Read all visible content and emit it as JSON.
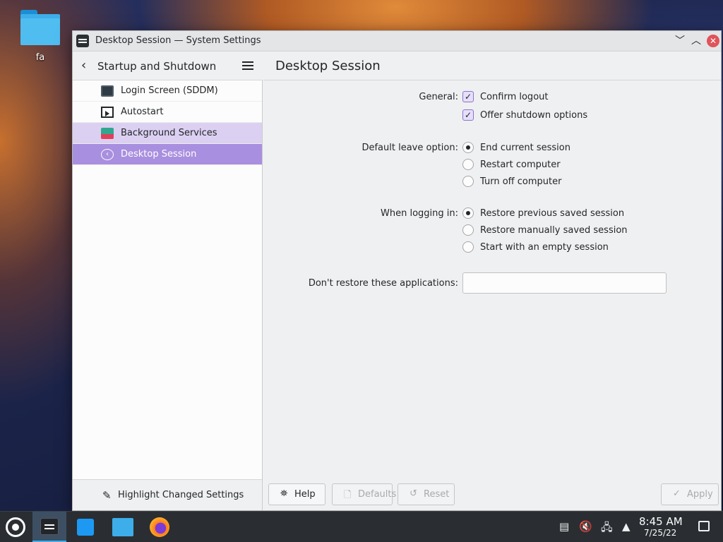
{
  "desktop": {
    "icons": [
      {
        "label": "fa",
        "icon": "folder-icon"
      }
    ]
  },
  "window": {
    "title": "Desktop Session — System Settings",
    "controls": {
      "minimize": "﹀",
      "maximize": "︿",
      "close": "✕"
    }
  },
  "sidebar": {
    "heading": "Startup and Shutdown",
    "items": [
      {
        "label": "Login Screen (SDDM)",
        "icon": "monitor-icon"
      },
      {
        "label": "Autostart",
        "icon": "autostart-icon"
      },
      {
        "label": "Background Services",
        "icon": "background-services-icon"
      },
      {
        "label": "Desktop Session",
        "icon": "session-icon"
      }
    ],
    "footer_label": "Highlight Changed Settings"
  },
  "main": {
    "title": "Desktop Session",
    "general": {
      "label": "General:",
      "options": [
        {
          "label": "Confirm logout",
          "checked": true
        },
        {
          "label": "Offer shutdown options",
          "checked": true
        }
      ]
    },
    "leave": {
      "label": "Default leave option:",
      "options": [
        {
          "label": "End current session",
          "selected": true
        },
        {
          "label": "Restart computer",
          "selected": false
        },
        {
          "label": "Turn off computer",
          "selected": false
        }
      ]
    },
    "login": {
      "label": "When logging in:",
      "options": [
        {
          "label": "Restore previous saved session",
          "selected": true
        },
        {
          "label": "Restore manually saved session",
          "selected": false
        },
        {
          "label": "Start with an empty session",
          "selected": false
        }
      ]
    },
    "exclude": {
      "label": "Don't restore these applications:",
      "value": ""
    }
  },
  "buttons": {
    "help": "Help",
    "defaults": "Defaults",
    "reset": "Reset",
    "apply": "Apply"
  },
  "taskbar": {
    "time": "8:45 AM",
    "date": "7/25/22"
  },
  "colors": {
    "accent": "#a98fdf",
    "accent_light": "#dcd0f2",
    "taskbar": "#2a2e32"
  }
}
